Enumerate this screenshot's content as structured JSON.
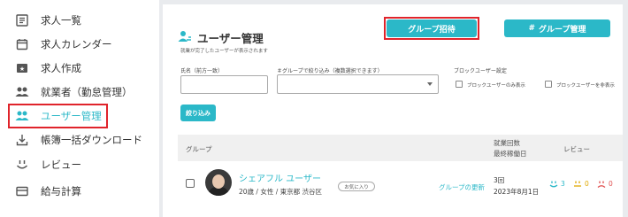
{
  "sidebar": {
    "items": [
      {
        "label": "求人一覧",
        "icon": "job-list-icon"
      },
      {
        "label": "求人カレンダー",
        "icon": "calendar-icon"
      },
      {
        "label": "求人作成",
        "icon": "job-create-icon"
      },
      {
        "label": "就業者（勤怠管理）",
        "icon": "workers-icon"
      },
      {
        "label": "ユーザー管理",
        "icon": "user-management-icon"
      },
      {
        "label": "帳簿一括ダウンロード",
        "icon": "download-icon"
      },
      {
        "label": "レビュー",
        "icon": "review-icon"
      },
      {
        "label": "給与計算",
        "icon": "payroll-icon"
      }
    ]
  },
  "header": {
    "title": "ユーザー管理",
    "subtitle": "就業が完了したユーザーが表示されます",
    "invite_button": "グループ招待",
    "group_button": "グループ管理",
    "group_button_icon": "#"
  },
  "filters": {
    "name_label": "氏名（前方一致）",
    "group_label": "＃グループで絞り込み（複数選択できます）",
    "block_label": "ブロックユーザー設定",
    "block_only": "ブロックユーザーのみ表示",
    "block_hide": "ブロックユーザーを非表示",
    "submit": "絞り込み"
  },
  "table": {
    "col_group": "グループ",
    "col_work_count": "就業回数",
    "col_last_work": "最終稼働日",
    "col_review": "レビュー",
    "rows": [
      {
        "name": "シェアフル ユーザー",
        "meta": "20歳 / 女性 / 東京都 渋谷区",
        "badge": "お気に入り",
        "group_update": "グループの更新",
        "work_count": "3回",
        "last_work": "2023年8月1日",
        "review_good": "3",
        "review_neutral": "0",
        "review_bad": "0"
      }
    ]
  },
  "colors": {
    "accent": "#2bb8c8",
    "highlight": "#e0242b",
    "review_good": "#2bb8c8",
    "review_neutral": "#e0a800",
    "review_bad": "#e05050"
  }
}
